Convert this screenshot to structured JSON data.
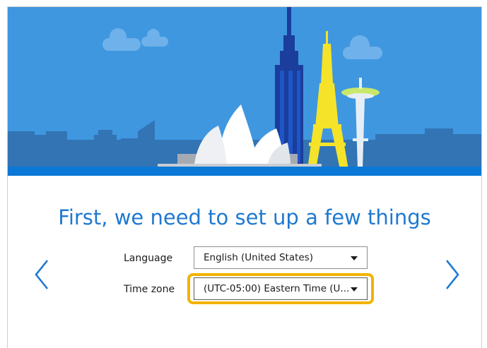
{
  "setup": {
    "headline": "First, we need to set up a few things",
    "language": {
      "label": "Language",
      "value": "English (United States)"
    },
    "timezone": {
      "label": "Time zone",
      "value": "(UTC-05:00) Eastern Time (U..."
    },
    "icons": {
      "back": "chevron-left-icon",
      "next": "chevron-right-icon",
      "dropdown": "caret-down-icon"
    },
    "colors": {
      "accent": "#1f79d0",
      "sky": "#3f97e0",
      "focus": "#f2b300"
    }
  }
}
